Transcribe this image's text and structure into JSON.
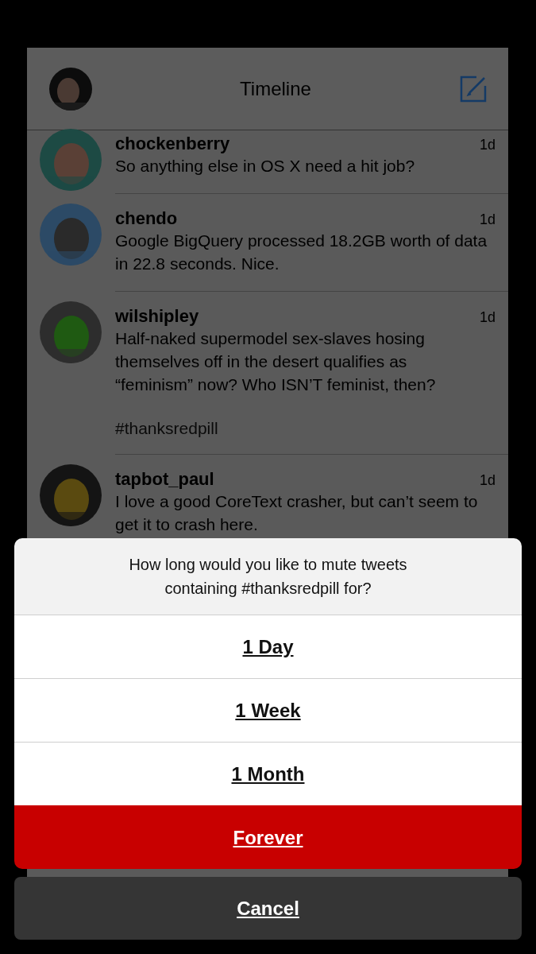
{
  "header": {
    "title": "Timeline"
  },
  "tweets": [
    {
      "user": "chockenberry",
      "text": "So anything else in OS X need a hit job?",
      "time": "1d"
    },
    {
      "user": "chendo",
      "text": "Google BigQuery processed 18.2GB worth of data in 22.8 seconds. Nice.",
      "time": "1d"
    },
    {
      "user": "wilshipley",
      "text": "Half-naked supermodel sex-slaves hosing themselves off in the desert qualifies as “feminism” now? Who ISN’T feminist, then?",
      "hashtag": "#thanksredpill",
      "time": "1d"
    },
    {
      "user": "tapbot_paul",
      "text": "I love a good CoreText crasher, but can’t seem to get it to crash here.",
      "time": "1d"
    }
  ],
  "action_sheet": {
    "message": "How long would you like to mute tweets containing #thanksredpill for?",
    "options": [
      {
        "label": "1 Day",
        "kind": "normal"
      },
      {
        "label": "1 Week",
        "kind": "normal"
      },
      {
        "label": "1 Month",
        "kind": "normal"
      },
      {
        "label": "Forever",
        "kind": "destructive"
      }
    ],
    "cancel": "Cancel"
  }
}
